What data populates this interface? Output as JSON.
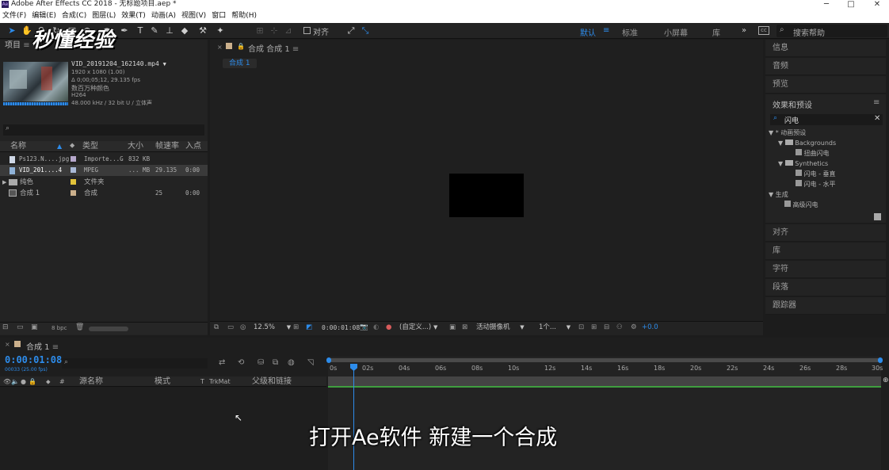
{
  "window": {
    "title": "Adobe After Effects CC 2018 - 无标题项目.aep *",
    "minimize": "─",
    "maximize": "□",
    "close": "✕"
  },
  "menu": [
    "文件(F)",
    "编辑(E)",
    "合成(C)",
    "图层(L)",
    "效果(T)",
    "动画(A)",
    "视图(V)",
    "窗口",
    "帮助(H)"
  ],
  "toolbar": {
    "align_label": "对齐",
    "workspaces": [
      "默认",
      "标准",
      "小屏幕",
      "库"
    ],
    "more": "»",
    "search_placeholder": "搜索帮助"
  },
  "watermark": "秒懂经验",
  "project": {
    "tab_label": "项目",
    "selected": {
      "filename": "VID_20191204_162140.mp4",
      "dims": "1920 x 1080 (1.00)",
      "duration": "Δ 0;00;05;12, 29.135 fps",
      "colors": "数百万种颜色",
      "codec": "H264",
      "audio": "48.000 kHz / 32 bit U / 立体声"
    },
    "columns": [
      "名称",
      "类型",
      "大小",
      "帧速率",
      "入点"
    ],
    "items": [
      {
        "name": "Ps123.N....jpg",
        "type": "Importe...G",
        "size": "832 KB",
        "fps": "",
        "in": ""
      },
      {
        "name": "VID_201....4",
        "type": "MPEG",
        "size": "... MB",
        "fps": "29.135",
        "in": "0:00"
      },
      {
        "name": "纯色",
        "type": "文件夹",
        "size": "",
        "fps": "",
        "in": ""
      },
      {
        "name": "合成 1",
        "type": "合成",
        "size": "",
        "fps": "25",
        "in": "0:00"
      }
    ],
    "bpc": "8 bpc"
  },
  "composition": {
    "tab_label": "合成 合成 1",
    "breadcrumb": "合成 1",
    "zoom": "12.5%",
    "time": "0:00:01:08",
    "resolution": "(自定义...)",
    "camera": "活动摄像机",
    "views": "1个...",
    "exposure": "+0.0"
  },
  "right_panels": {
    "top": [
      "信息",
      "音频",
      "预览"
    ],
    "effects_title": "效果和预设",
    "effects_search": "闪电",
    "tree": {
      "animation_presets": "* 动画预设",
      "backgrounds": "Backgrounds",
      "bg_item": "扭曲闪电",
      "synthetics": "Synthetics",
      "syn_item1": "闪电 - 垂直",
      "syn_item2": "闪电 - 水平",
      "generate": "生成",
      "gen_item": "高级闪电"
    },
    "bottom": [
      "对齐",
      "库",
      "字符",
      "段落",
      "跟踪器"
    ]
  },
  "timeline": {
    "tab_label": "合成 1",
    "timecode": "0:00:01:08",
    "timecode_sub": "00033 (25.00 fps)",
    "columns": [
      "源名称",
      "模式",
      "T",
      "TrkMat",
      "父级和链接"
    ],
    "ticks": [
      "0s",
      "02s",
      "04s",
      "06s",
      "08s",
      "10s",
      "12s",
      "14s",
      "16s",
      "18s",
      "20s",
      "22s",
      "24s",
      "26s",
      "28s",
      "30s"
    ]
  },
  "subtitle": "打开Ae软件 新建一个合成",
  "colors": {
    "accent": "#2d8ceb",
    "panel_bg": "#232323",
    "app_bg": "#1c1c1c"
  }
}
